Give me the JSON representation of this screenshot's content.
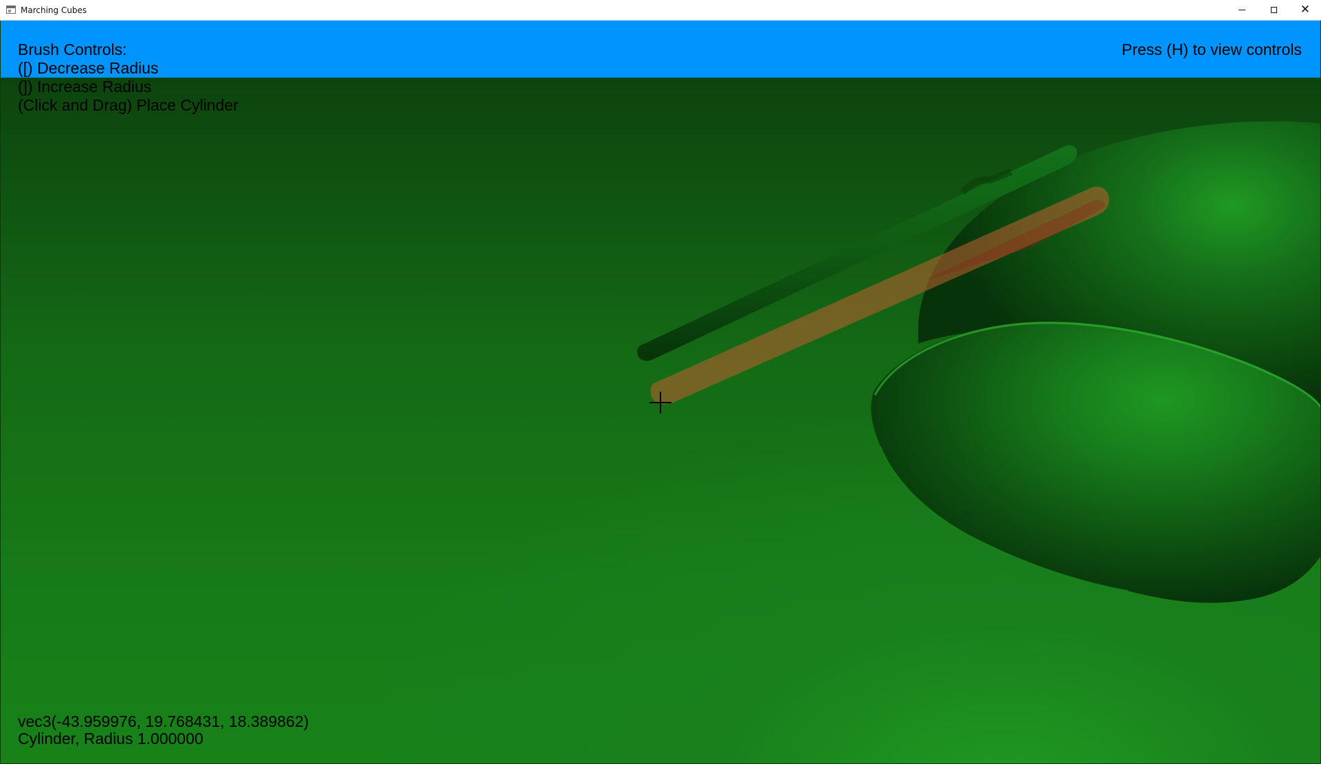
{
  "window": {
    "title": "Marching Cubes",
    "controls": {
      "minimize": "minimize",
      "maximize": "maximize",
      "close": "close"
    }
  },
  "overlay": {
    "brush_controls_title": "Brush Controls:",
    "controls": [
      "([) Decrease Radius",
      "(]) Increase Radius",
      "(Click and Drag) Place Cylinder"
    ],
    "help_hint": "Press (H) to view controls",
    "position_readout": "vec3(-43.959976, 19.768431, 18.389862)",
    "brush_readout": "Cylinder, Radius 1.000000"
  },
  "scene": {
    "terrain_color": "#178019",
    "header_band_color": "#0094fe",
    "placed_cylinder_color": "#0f5a12",
    "brush_preview_color": "#b85e2e"
  }
}
